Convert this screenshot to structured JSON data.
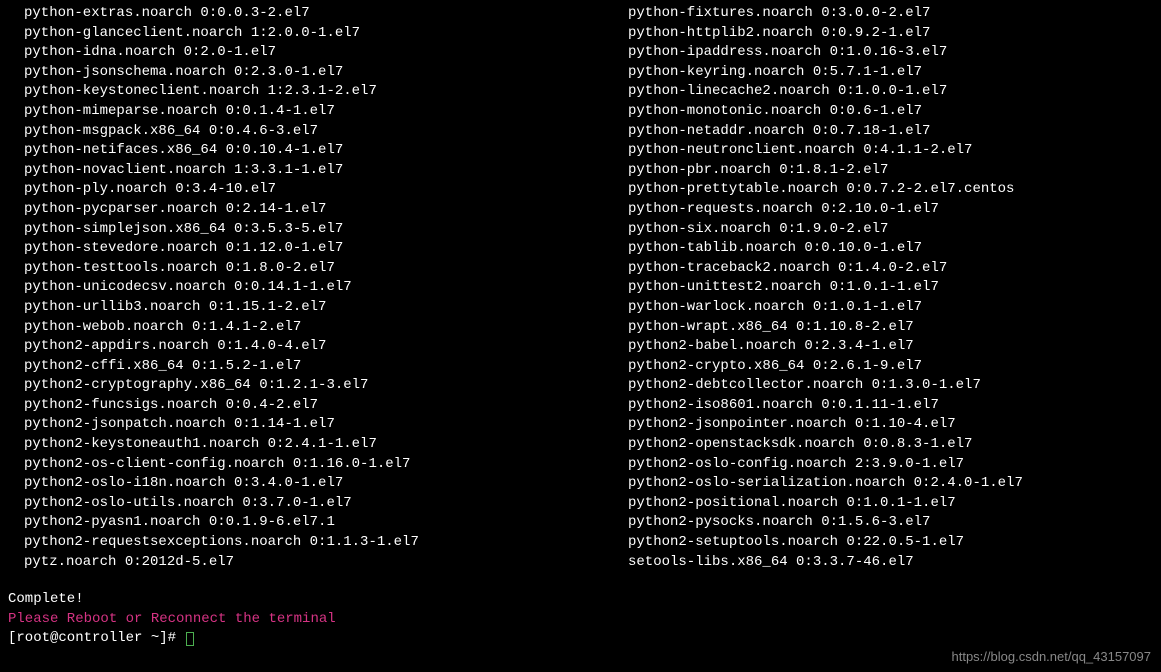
{
  "packages_left": [
    "python-extras.noarch 0:0.0.3-2.el7",
    "python-glanceclient.noarch 1:2.0.0-1.el7",
    "python-idna.noarch 0:2.0-1.el7",
    "python-jsonschema.noarch 0:2.3.0-1.el7",
    "python-keystoneclient.noarch 1:2.3.1-2.el7",
    "python-mimeparse.noarch 0:0.1.4-1.el7",
    "python-msgpack.x86_64 0:0.4.6-3.el7",
    "python-netifaces.x86_64 0:0.10.4-1.el7",
    "python-novaclient.noarch 1:3.3.1-1.el7",
    "python-ply.noarch 0:3.4-10.el7",
    "python-pycparser.noarch 0:2.14-1.el7",
    "python-simplejson.x86_64 0:3.5.3-5.el7",
    "python-stevedore.noarch 0:1.12.0-1.el7",
    "python-testtools.noarch 0:1.8.0-2.el7",
    "python-unicodecsv.noarch 0:0.14.1-1.el7",
    "python-urllib3.noarch 0:1.15.1-2.el7",
    "python-webob.noarch 0:1.4.1-2.el7",
    "python2-appdirs.noarch 0:1.4.0-4.el7",
    "python2-cffi.x86_64 0:1.5.2-1.el7",
    "python2-cryptography.x86_64 0:1.2.1-3.el7",
    "python2-funcsigs.noarch 0:0.4-2.el7",
    "python2-jsonpatch.noarch 0:1.14-1.el7",
    "python2-keystoneauth1.noarch 0:2.4.1-1.el7",
    "python2-os-client-config.noarch 0:1.16.0-1.el7",
    "python2-oslo-i18n.noarch 0:3.4.0-1.el7",
    "python2-oslo-utils.noarch 0:3.7.0-1.el7",
    "python2-pyasn1.noarch 0:0.1.9-6.el7.1",
    "python2-requestsexceptions.noarch 0:1.1.3-1.el7",
    "pytz.noarch 0:2012d-5.el7"
  ],
  "packages_right": [
    "python-fixtures.noarch 0:3.0.0-2.el7",
    "python-httplib2.noarch 0:0.9.2-1.el7",
    "python-ipaddress.noarch 0:1.0.16-3.el7",
    "python-keyring.noarch 0:5.7.1-1.el7",
    "python-linecache2.noarch 0:1.0.0-1.el7",
    "python-monotonic.noarch 0:0.6-1.el7",
    "python-netaddr.noarch 0:0.7.18-1.el7",
    "python-neutronclient.noarch 0:4.1.1-2.el7",
    "python-pbr.noarch 0:1.8.1-2.el7",
    "python-prettytable.noarch 0:0.7.2-2.el7.centos",
    "python-requests.noarch 0:2.10.0-1.el7",
    "python-six.noarch 0:1.9.0-2.el7",
    "python-tablib.noarch 0:0.10.0-1.el7",
    "python-traceback2.noarch 0:1.4.0-2.el7",
    "python-unittest2.noarch 0:1.0.1-1.el7",
    "python-warlock.noarch 0:1.0.1-1.el7",
    "python-wrapt.x86_64 0:1.10.8-2.el7",
    "python2-babel.noarch 0:2.3.4-1.el7",
    "python2-crypto.x86_64 0:2.6.1-9.el7",
    "python2-debtcollector.noarch 0:1.3.0-1.el7",
    "python2-iso8601.noarch 0:0.1.11-1.el7",
    "python2-jsonpointer.noarch 0:1.10-4.el7",
    "python2-openstacksdk.noarch 0:0.8.3-1.el7",
    "python2-oslo-config.noarch 2:3.9.0-1.el7",
    "python2-oslo-serialization.noarch 0:2.4.0-1.el7",
    "python2-positional.noarch 0:1.0.1-1.el7",
    "python2-pysocks.noarch 0:1.5.6-3.el7",
    "python2-setuptools.noarch 0:22.0.5-1.el7",
    "setools-libs.x86_64 0:3.3.7-46.el7"
  ],
  "complete_text": "Complete!",
  "reboot_text": "Please Reboot or Reconnect the terminal",
  "prompt": "[root@controller ~]# ",
  "watermark": "https://blog.csdn.net/qq_43157097"
}
